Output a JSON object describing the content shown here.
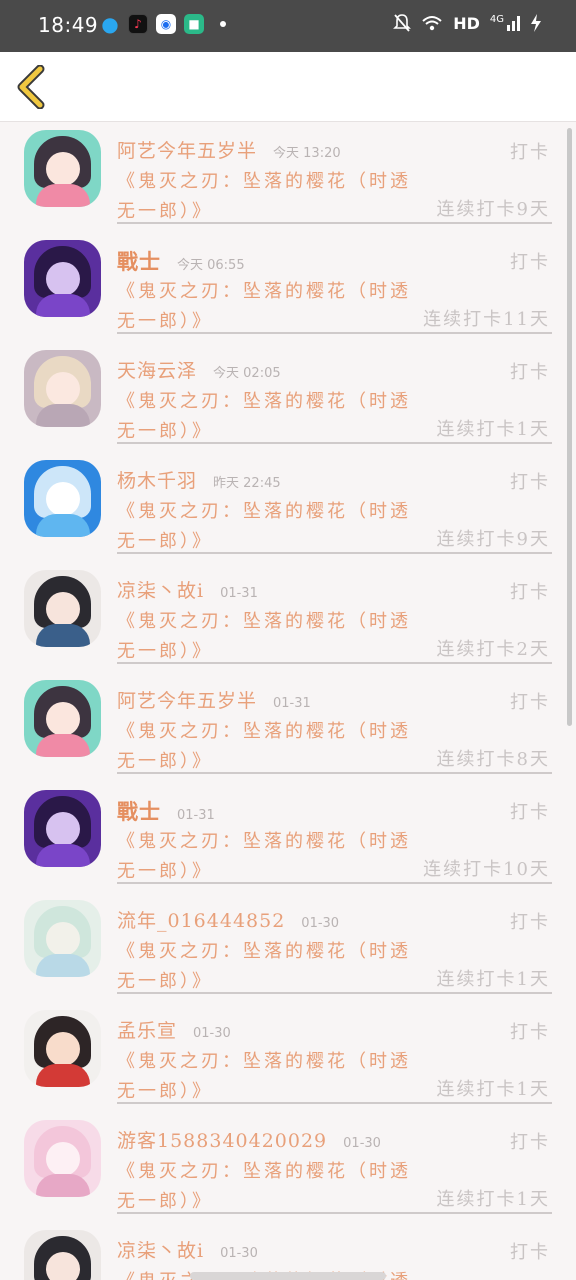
{
  "status_bar": {
    "time": "18:49",
    "network": "HD",
    "signal": "4G",
    "icons": [
      "qq-icon",
      "tiktok-icon",
      "browser-icon",
      "messages-icon",
      "mute-bell-icon",
      "wifi-icon",
      "signal-icon",
      "charging-icon"
    ]
  },
  "header": {
    "back_icon": "chevron-left-icon"
  },
  "colors": {
    "accent_text": "#e8a07a",
    "muted_text": "#c9c4c4",
    "back_chevron": "#e8c040"
  },
  "entries": [
    {
      "name": "阿艺今年五岁半",
      "time": "今天 13:20",
      "action": "打卡",
      "title_line1": "《鬼灭之刃：坠落的樱花（时透",
      "title_line2": "无一郎）》",
      "streak": "连续打卡9天",
      "avatar": "anime-girl-dark-hair"
    },
    {
      "name": "戰士",
      "time": "今天 06:55",
      "action": "打卡",
      "title_line1": "《鬼灭之刃：坠落的樱花（时透",
      "title_line2": "无一郎）》",
      "streak": "连续打卡11天",
      "avatar": "anime-purple-wisteria"
    },
    {
      "name": "天海云泽",
      "time": "今天 02:05",
      "action": "打卡",
      "title_line1": "《鬼灭之刃：坠落的樱花（时透",
      "title_line2": "无一郎）》",
      "streak": "连续打卡1天",
      "avatar": "anime-girl-blonde"
    },
    {
      "name": "杨木千羽",
      "time": "昨天 22:45",
      "action": "打卡",
      "title_line1": "《鬼灭之刃：坠落的樱花（时透",
      "title_line2": "无一郎）》",
      "streak": "连续打卡9天",
      "avatar": "anime-blue-flowers"
    },
    {
      "name": "凉柒丶故i",
      "time": "01-31",
      "action": "打卡",
      "title_line1": "《鬼灭之刃：坠落的樱花（时透",
      "title_line2": "无一郎）》",
      "streak": "连续打卡2天",
      "avatar": "anime-girl-long-hair"
    },
    {
      "name": "阿艺今年五岁半",
      "time": "01-31",
      "action": "打卡",
      "title_line1": "《鬼灭之刃：坠落的樱花（时透",
      "title_line2": "无一郎）》",
      "streak": "连续打卡8天",
      "avatar": "anime-girl-dark-hair"
    },
    {
      "name": "戰士",
      "time": "01-31",
      "action": "打卡",
      "title_line1": "《鬼灭之刃：坠落的樱花（时透",
      "title_line2": "无一郎）》",
      "streak": "连续打卡10天",
      "avatar": "anime-purple-wisteria"
    },
    {
      "name": "流年_016444852",
      "time": "01-30",
      "action": "打卡",
      "title_line1": "《鬼灭之刃：坠落的樱花（时透",
      "title_line2": "无一郎）》",
      "streak": "连续打卡1天",
      "avatar": "pastel-watercolor"
    },
    {
      "name": "孟乐宣",
      "time": "01-30",
      "action": "打卡",
      "title_line1": "《鬼灭之刃：坠落的樱花（时透",
      "title_line2": "无一郎）》",
      "streak": "连续打卡1天",
      "avatar": "anime-boy-cap"
    },
    {
      "name": "游客1588340420029",
      "time": "01-30",
      "action": "打卡",
      "title_line1": "《鬼灭之刃：坠落的樱花（时透",
      "title_line2": "无一郎）》",
      "streak": "连续打卡1天",
      "avatar": "anime-girl-pink-dress"
    },
    {
      "name": "凉柒丶故i",
      "time": "01-30",
      "action": "打卡",
      "title_line1": "《鬼灭之刃：坠落的樱花（时透",
      "title_line2": "",
      "streak": "",
      "avatar": "anime-girl-long-hair"
    }
  ]
}
